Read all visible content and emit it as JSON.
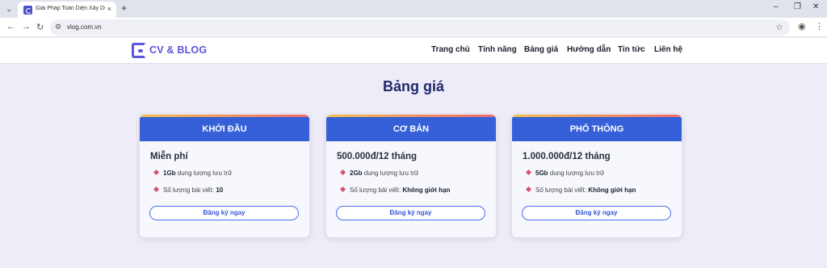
{
  "browser": {
    "tab_title": "Giải Pháp Toàn Diện Xây Dựng",
    "tab_close": "×",
    "new_tab": "+",
    "url": "vlog.com.vn",
    "window_controls": {
      "minimize": "–",
      "restore": "❐",
      "close": "✕"
    }
  },
  "header": {
    "logo_text": "CV & BLOG",
    "nav": [
      "Trang chủ",
      "Tính năng",
      "Bảng giá",
      "Hướng dẫn",
      "Tin tức",
      "Liên hệ"
    ]
  },
  "main": {
    "title": "Bảng giá",
    "plans": [
      {
        "name": "KHỞI ĐẦU",
        "price": "Miễn phí",
        "storage_value": "1Gb",
        "storage_text": " dung lượng lưu trữ",
        "posts_label": "Số lượng bài viết: ",
        "posts_value": "10",
        "button": "Đăng ký ngay"
      },
      {
        "name": "CƠ BẢN",
        "price": "500.000đ/12 tháng",
        "storage_value": "2Gb",
        "storage_text": " dung lượng lưu trữ",
        "posts_label": "Số lượng bài viết: ",
        "posts_value": "Không giới hạn",
        "button": "Đăng ký ngay"
      },
      {
        "name": "PHỔ THÔNG",
        "price": "1.000.000đ/12 tháng",
        "storage_value": "5Gb",
        "storage_text": " dung lượng lưu trữ",
        "posts_label": "Số lượng bài viết: ",
        "posts_value": "Không giới hạn",
        "button": "Đăng ký ngay"
      }
    ]
  },
  "colors": {
    "page_bg": "#eeecf6",
    "brand": "#5b57d6",
    "card_header": "#3560d8",
    "bullet": "#d7536d",
    "title": "#1f2a6b"
  }
}
